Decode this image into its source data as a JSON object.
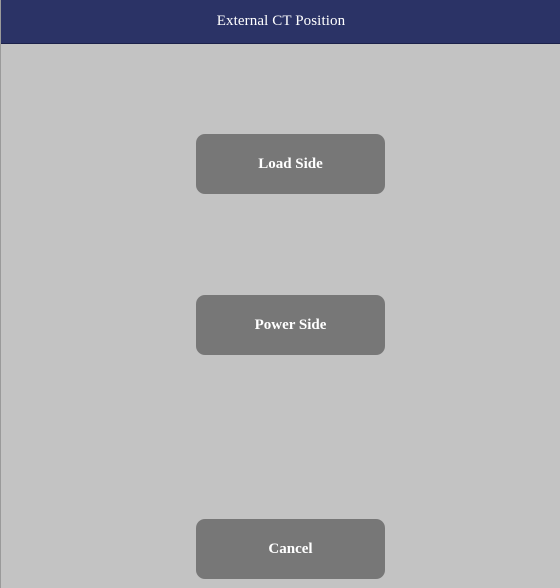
{
  "window": {
    "title": "External CT Position"
  },
  "buttons": {
    "load_side": "Load Side",
    "power_side": "Power Side",
    "cancel": "Cancel"
  },
  "colors": {
    "title_bar": "#2b3366",
    "background": "#c3c3c3",
    "button": "#777777",
    "text": "#ffffff"
  }
}
